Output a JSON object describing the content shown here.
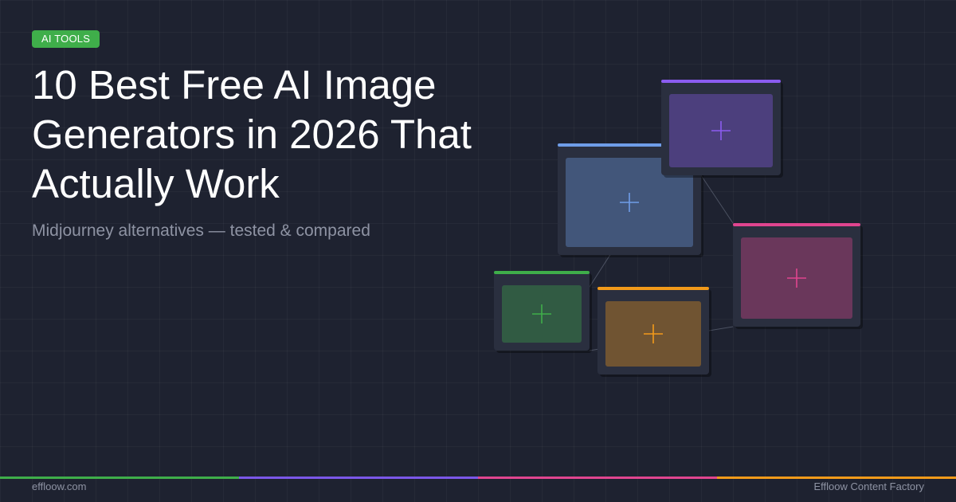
{
  "badge": {
    "label": "AI TOOLS",
    "color": "#3fae4a"
  },
  "headline": "10 Best Free AI Image Generators in 2026 That Actually Work",
  "subtitle": "Midjourney alternatives — tested & compared",
  "footer": {
    "site": "effloow.com",
    "brand": "Effloow Content Factory"
  },
  "colors": {
    "background": "#1e2230",
    "text_primary": "#ffffff",
    "text_muted": "#8e93a3",
    "green": "#3fae4a",
    "purple": "#7b57e8",
    "pink": "#e0458f",
    "orange": "#f29a1a",
    "blue": "#6f9de8"
  },
  "illustration": {
    "cards": [
      {
        "name": "card-blue",
        "accent": "#6f9de8",
        "icon": "crosshair-icon"
      },
      {
        "name": "card-purple",
        "accent": "#8b5cf0",
        "icon": "crosshair-icon"
      },
      {
        "name": "card-pink",
        "accent": "#e0458f",
        "icon": "crosshair-icon"
      },
      {
        "name": "card-green",
        "accent": "#3fae4a",
        "icon": "crosshair-icon"
      },
      {
        "name": "card-orange",
        "accent": "#f29a1a",
        "icon": "crosshair-icon"
      }
    ]
  },
  "bottom_bar": [
    "#3fae4a",
    "#7b57e8",
    "#e0458f",
    "#f29a1a"
  ]
}
